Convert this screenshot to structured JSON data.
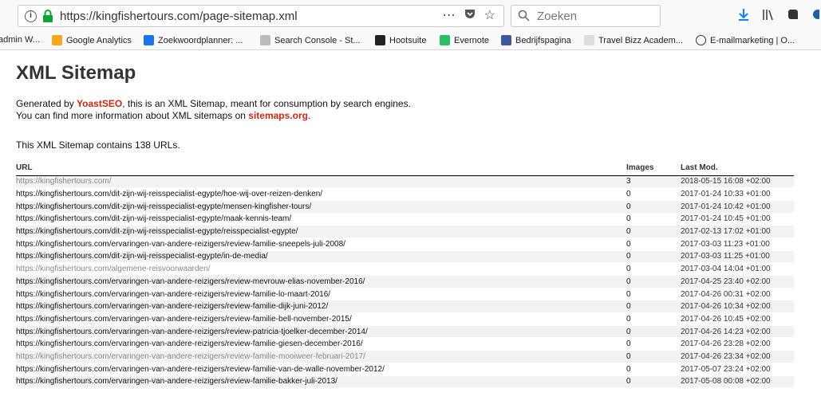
{
  "browser": {
    "url": "https://kingfishertours.com/page-sitemap.xml",
    "search_placeholder": "Zoeken",
    "url_actions": [
      "⋯",
      "◊",
      "☆"
    ],
    "bookmarks": [
      {
        "label": "admin W...",
        "color": "#ffffff"
      },
      {
        "label": "Google Analytics",
        "color": "#f4a81d"
      },
      {
        "label": "Zoekwoordplanner: ...",
        "color": "#1a73e8"
      },
      {
        "label": "Search Console - St...",
        "color": "#bcbcbc"
      },
      {
        "label": "Hootsuite",
        "color": "#222222"
      },
      {
        "label": "Evernote",
        "color": "#2dbe60"
      },
      {
        "label": "Bedrijfspagina",
        "color": "#3b5998"
      },
      {
        "label": "Travel Bizz Academ...",
        "color": "#cccccc"
      },
      {
        "label": "E-mailmarketing | O...",
        "color": "#ffffff"
      }
    ]
  },
  "page": {
    "title": "XML Sitemap",
    "desc_prefix": "Generated by ",
    "desc_link1": "YoastSEO",
    "desc_mid": ", this is an XML Sitemap, meant for consumption by search engines.",
    "desc_line2_prefix": "You can find more information about XML sitemaps on ",
    "desc_link2": "sitemaps.org",
    "desc_line2_suffix": ".",
    "count_text": "This XML Sitemap contains 138 URLs."
  },
  "table": {
    "headers": {
      "url": "URL",
      "images": "Images",
      "lastmod": "Last Mod."
    },
    "rows": [
      {
        "url": "https://kingfishertours.com/",
        "images": "3",
        "lastmod": "2018-05-15 16:08 +02:00",
        "faded": true
      },
      {
        "url": "https://kingfishertours.com/dit-zijn-wij-reisspecialist-egypte/hoe-wij-over-reizen-denken/",
        "images": "0",
        "lastmod": "2017-01-24 10:33 +01:00",
        "faded": false
      },
      {
        "url": "https://kingfishertours.com/dit-zijn-wij-reisspecialist-egypte/mensen-kingfisher-tours/",
        "images": "0",
        "lastmod": "2017-01-24 10:42 +01:00",
        "faded": false
      },
      {
        "url": "https://kingfishertours.com/dit-zijn-wij-reisspecialist-egypte/maak-kennis-team/",
        "images": "0",
        "lastmod": "2017-01-24 10:45 +01:00",
        "faded": false
      },
      {
        "url": "https://kingfishertours.com/dit-zijn-wij-reisspecialist-egypte/reisspecialist-egypte/",
        "images": "0",
        "lastmod": "2017-02-13 17:02 +01:00",
        "faded": false
      },
      {
        "url": "https://kingfishertours.com/ervaringen-van-andere-reizigers/review-familie-sneepels-juli-2008/",
        "images": "0",
        "lastmod": "2017-03-03 11:23 +01:00",
        "faded": false
      },
      {
        "url": "https://kingfishertours.com/dit-zijn-wij-reisspecialist-egypte/in-de-media/",
        "images": "0",
        "lastmod": "2017-03-03 11:25 +01:00",
        "faded": false
      },
      {
        "url": "https://kingfishertours.com/algemene-reisvoorwaarden/",
        "images": "0",
        "lastmod": "2017-03-04 14:04 +01:00",
        "faded": true
      },
      {
        "url": "https://kingfishertours.com/ervaringen-van-andere-reizigers/review-mevrouw-elias-november-2016/",
        "images": "0",
        "lastmod": "2017-04-25 23:40 +02:00",
        "faded": false
      },
      {
        "url": "https://kingfishertours.com/ervaringen-van-andere-reizigers/review-familie-lo-maart-2016/",
        "images": "0",
        "lastmod": "2017-04-26 00:31 +02:00",
        "faded": false
      },
      {
        "url": "https://kingfishertours.com/ervaringen-van-andere-reizigers/review-familie-dijk-juni-2012/",
        "images": "0",
        "lastmod": "2017-04-26 10:34 +02:00",
        "faded": false
      },
      {
        "url": "https://kingfishertours.com/ervaringen-van-andere-reizigers/review-familie-bell-november-2015/",
        "images": "0",
        "lastmod": "2017-04-26 10:45 +02:00",
        "faded": false
      },
      {
        "url": "https://kingfishertours.com/ervaringen-van-andere-reizigers/review-patricia-tjoelker-december-2014/",
        "images": "0",
        "lastmod": "2017-04-26 14:23 +02:00",
        "faded": false
      },
      {
        "url": "https://kingfishertours.com/ervaringen-van-andere-reizigers/review-familie-giesen-december-2016/",
        "images": "0",
        "lastmod": "2017-04-26 23:28 +02:00",
        "faded": false
      },
      {
        "url": "https://kingfishertours.com/ervaringen-van-andere-reizigers/review-familie-mooiweer-februari-2017/",
        "images": "0",
        "lastmod": "2017-04-26 23:34 +02:00",
        "faded": true
      },
      {
        "url": "https://kingfishertours.com/ervaringen-van-andere-reizigers/review-familie-van-de-walle-november-2012/",
        "images": "0",
        "lastmod": "2017-05-07 23:24 +02:00",
        "faded": false
      },
      {
        "url": "https://kingfishertours.com/ervaringen-van-andere-reizigers/review-familie-bakker-juli-2013/",
        "images": "0",
        "lastmod": "2017-05-08 00:08 +02:00",
        "faded": false
      }
    ]
  }
}
